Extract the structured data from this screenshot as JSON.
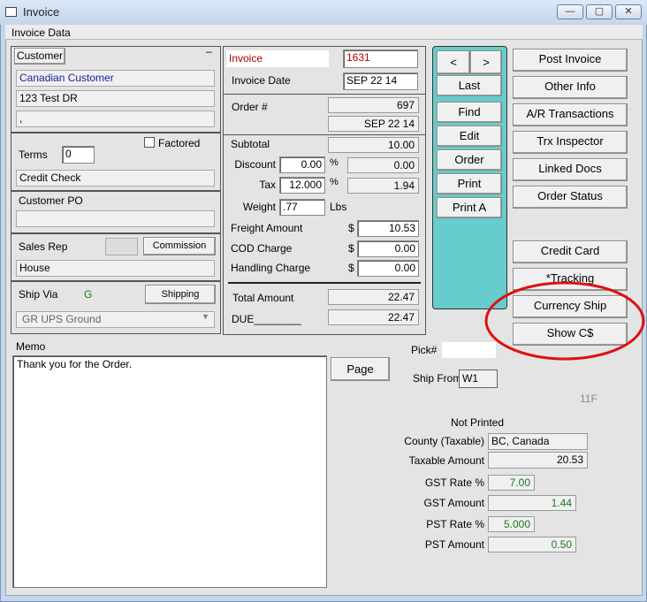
{
  "window": {
    "title": "Invoice",
    "min_label": "—",
    "max_label": "▢",
    "close_label": "✕"
  },
  "menu": {
    "label": "Invoice Data"
  },
  "customer": {
    "button": "Customer",
    "dash": "–",
    "name": "Canadian Customer",
    "address": "123 Test DR",
    "line3": ","
  },
  "terms": {
    "label": "Terms",
    "value": "0",
    "factored": "Factored",
    "credit": "Credit Check"
  },
  "customer_po": {
    "label": "Customer PO",
    "value": ""
  },
  "sales": {
    "label": "Sales Rep",
    "commission": "Commission",
    "value": "House"
  },
  "ship_via": {
    "label": "Ship Via",
    "code": "G",
    "shipping": "Shipping",
    "method": "GR   UPS Ground"
  },
  "invoice": {
    "label": "Invoice",
    "number": "1631",
    "date_label": "Invoice Date",
    "date": "SEP 22 14",
    "order_label": "Order #",
    "order_number": "697",
    "order_date": "SEP 22 14"
  },
  "totals": {
    "subtotal_label": "Subtotal",
    "subtotal": "10.00",
    "discount_label": "Discount",
    "discount_pct": "0.00",
    "discount": "0.00",
    "tax_label": "Tax",
    "tax_pct": "12.000",
    "tax": "1.94",
    "pct": "%",
    "weight_label": "Weight",
    "weight": ".77",
    "weight_unit": "Lbs",
    "freight_label": "Freight Amount",
    "freight": "10.53",
    "cod_label": "COD Charge",
    "cod": "0.00",
    "handling_label": "Handling Charge",
    "handling": "0.00",
    "dollar": "$",
    "total_label": "Total Amount",
    "total": "22.47",
    "due_label": "DUE________",
    "due": "22.47"
  },
  "nav": {
    "prev": "<",
    "next": ">",
    "last": "Last",
    "find": "Find",
    "edit": "Edit",
    "order": "Order",
    "print": "Print",
    "print_a": "Print A"
  },
  "actions": [
    "Post Invoice",
    "Other Info",
    "A/R Transactions",
    "Trx Inspector",
    "Linked Docs",
    "Order Status"
  ],
  "actions2": [
    "Credit Card",
    "*Tracking",
    "Currency Ship",
    "Show C$"
  ],
  "memo": {
    "label": "Memo",
    "text": "Thank you for the Order.",
    "page": "Page"
  },
  "pick": {
    "label": "Pick#",
    "value": ""
  },
  "ship_from": {
    "label": "Ship From",
    "value": "W1"
  },
  "code": "11F",
  "print_status": "Not Printed",
  "tax_info": {
    "county_label": "County (Taxable)",
    "county": "BC, Canada",
    "taxable_label": "Taxable Amount",
    "taxable": "20.53",
    "gst_rate_label": "GST Rate %",
    "gst_rate": "7.00",
    "gst_amount_label": "GST Amount",
    "gst_amount": "1.44",
    "pst_rate_label": "PST Rate %",
    "pst_rate": "5.000",
    "pst_amount_label": "PST Amount",
    "pst_amount": "0.50"
  },
  "colors": {
    "nav_panel": "#66cccc",
    "highlight_circle": "#e01010",
    "invoice_red": "#b00000",
    "green_text": "#1a7a1a",
    "customer_blue": "#1a1aa0"
  }
}
